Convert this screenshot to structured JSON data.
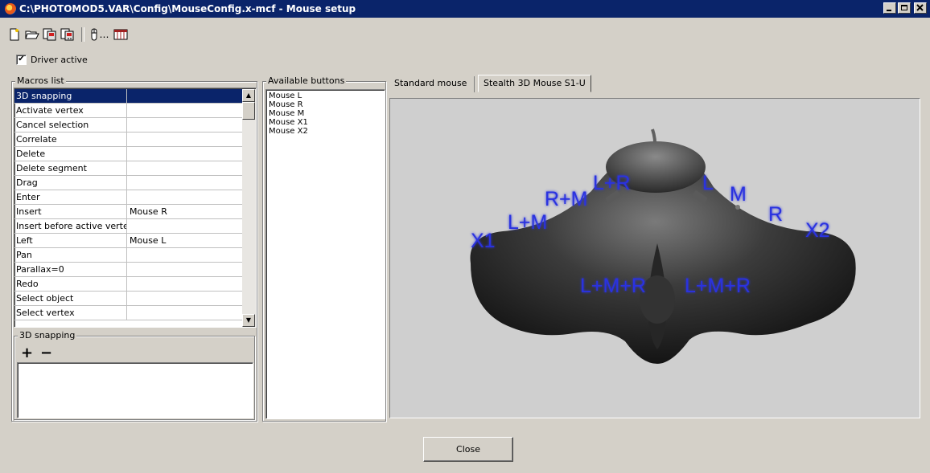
{
  "window": {
    "title": "C:\\PHOTOMOD5.VAR\\Config\\MouseConfig.x-mcf - Mouse setup"
  },
  "toolbar": {
    "icons": [
      "new-file-icon",
      "open-folder-icon",
      "save-icon",
      "save-as-icon",
      "mouse-config-icon",
      "table-icon"
    ],
    "mouse_icon_text": "…"
  },
  "driver": {
    "label": "Driver active",
    "checked": true,
    "check_mark": "✔"
  },
  "macros": {
    "title": "Macros list",
    "rows": [
      {
        "name": "3D snapping",
        "button": ""
      },
      {
        "name": "Activate vertex",
        "button": ""
      },
      {
        "name": "Cancel selection",
        "button": ""
      },
      {
        "name": "Correlate",
        "button": ""
      },
      {
        "name": "Delete",
        "button": ""
      },
      {
        "name": "Delete segment",
        "button": ""
      },
      {
        "name": "Drag",
        "button": ""
      },
      {
        "name": "Enter",
        "button": ""
      },
      {
        "name": "Insert",
        "button": "Mouse R"
      },
      {
        "name": "Insert before active verte",
        "button": ""
      },
      {
        "name": "Left",
        "button": "Mouse L"
      },
      {
        "name": "Pan",
        "button": ""
      },
      {
        "name": "Parallax=0",
        "button": ""
      },
      {
        "name": "Redo",
        "button": ""
      },
      {
        "name": "Select object",
        "button": ""
      },
      {
        "name": "Select vertex",
        "button": ""
      }
    ],
    "selected_index": 0
  },
  "snap_group": {
    "title": "3D snapping",
    "add_label": "+",
    "remove_label": "−"
  },
  "available": {
    "title": "Available buttons",
    "items": [
      "Mouse L",
      "Mouse R",
      "Mouse M",
      "Mouse X1",
      "Mouse X2"
    ]
  },
  "tabs": [
    {
      "label": "Standard mouse",
      "active": false
    },
    {
      "label": "Stealth 3D Mouse S1-U",
      "active": true
    }
  ],
  "mouse_labels": {
    "x1": "X1",
    "lm": "L+M",
    "rm": "R+M",
    "lr": "L+R",
    "l": "L",
    "m": "M",
    "r": "R",
    "x2": "X2",
    "lmr_left": "L+M+R",
    "lmr_right": "L+M+R"
  },
  "colors": {
    "titlebar": "#0a246a",
    "selection": "#0a246a",
    "mouse_label": "#2a33e0"
  },
  "close_label": "Close"
}
